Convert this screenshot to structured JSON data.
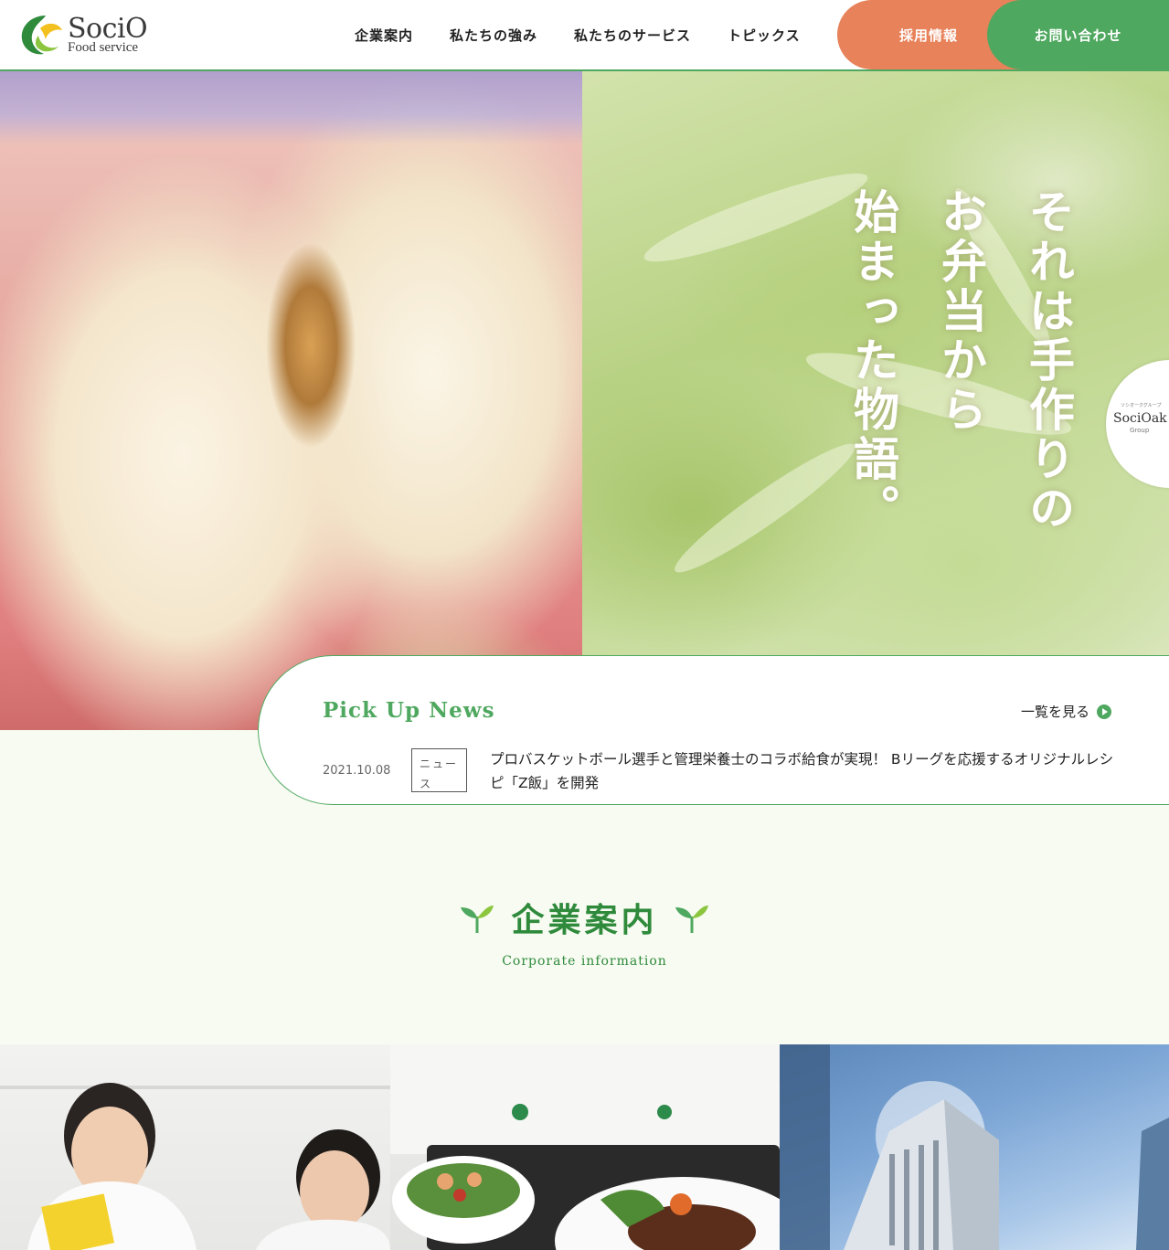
{
  "brand": {
    "logo_main": "SociO",
    "logo_sub": "Food service"
  },
  "nav": {
    "items": [
      {
        "label": "企業案内"
      },
      {
        "label": "私たちの強み"
      },
      {
        "label": "私たちのサービス"
      },
      {
        "label": "トピックス"
      }
    ],
    "recruit_label": "採用情報",
    "contact_label": "お問い合わせ"
  },
  "hero": {
    "lines": [
      "それは手作りの",
      "お弁当から",
      "始まった物語。"
    ]
  },
  "group_badge": {
    "tagline": "ソシオークグループ",
    "name": "SociOak",
    "sub": "Group"
  },
  "pickup": {
    "title": "Pick Up News",
    "view_all": "一覧を見る",
    "items": [
      {
        "date": "2021.10.08",
        "category": "ニュース",
        "text": "プロバスケットボール選手と管理栄養士のコラボ給食が実現！ Bリーグを応援するオリジナルレシピ「Z飯」を開発"
      }
    ]
  },
  "corporate": {
    "title": "企業案内",
    "subtitle": "Corporate information"
  },
  "colors": {
    "accent_green": "#4fa85f",
    "recruit_orange": "#e8825a",
    "heading_green": "#2f8a3c",
    "page_bg": "#f7fbf1"
  },
  "icons": {
    "logo": "socio-leaf-logo",
    "view_all": "play-circle-icon",
    "sprout": "sprout-icon"
  }
}
